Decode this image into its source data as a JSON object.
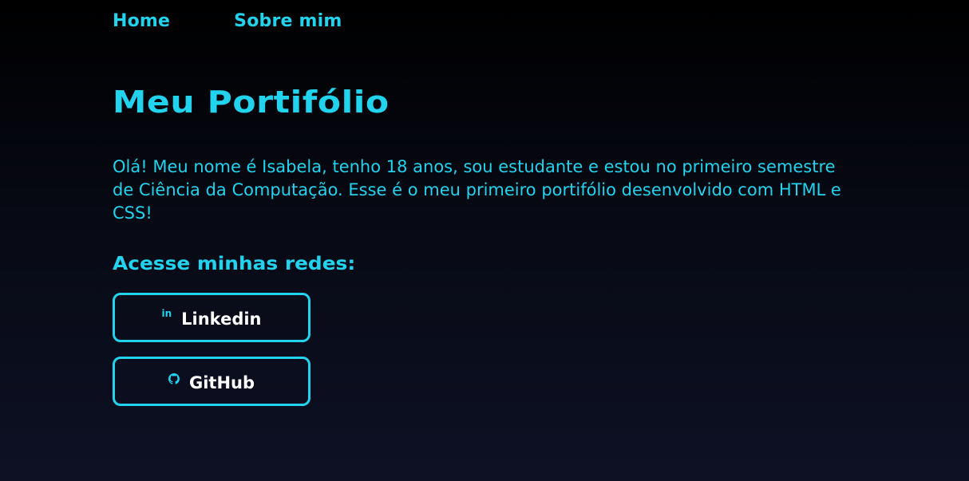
{
  "nav": {
    "items": [
      {
        "label": "Home"
      },
      {
        "label": "Sobre mim"
      }
    ]
  },
  "main": {
    "title": "Meu Portifólio",
    "bio": "Olá! Meu nome é Isabela, tenho 18 anos, sou estudante e estou no primeiro semestre de Ciência da Computação. Esse é o meu primeiro portifólio desenvolvido com HTML e CSS!",
    "social_heading": "Acesse minhas redes:",
    "social_links": [
      {
        "label": "Linkedin",
        "icon": "linkedin-icon",
        "icon_text": "in"
      },
      {
        "label": "GitHub",
        "icon": "github-icon"
      }
    ]
  },
  "colors": {
    "accent": "#22d3ee",
    "button_text": "#ffffff",
    "background_top": "#000000",
    "background_bottom": "#0e1124"
  }
}
